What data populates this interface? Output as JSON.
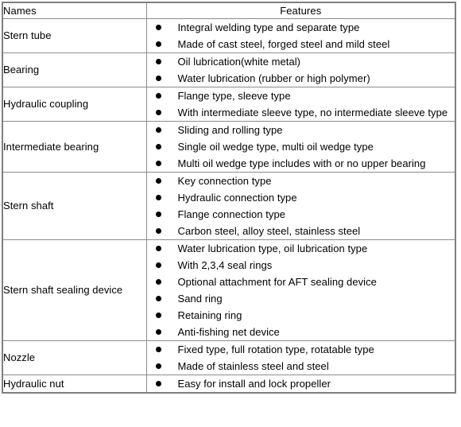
{
  "table": {
    "columns": [
      {
        "key": "names",
        "label": "Names",
        "align": "left"
      },
      {
        "key": "features",
        "label": "Features",
        "align": "center"
      }
    ],
    "bullet_glyph": "●",
    "border_color": "#7f7f7f",
    "text_color": "#000000",
    "background_color": "#ffffff",
    "rows": [
      {
        "name": "Stern tube",
        "features": [
          "Integral welding type and separate type",
          "Made of cast steel, forged steel and mild steel"
        ]
      },
      {
        "name": "Bearing",
        "features": [
          "Oil lubrication(white metal)",
          "Water lubrication (rubber or high polymer)"
        ]
      },
      {
        "name": "Hydraulic coupling",
        "features": [
          "Flange type, sleeve type",
          "With intermediate sleeve type, no intermediate sleeve type"
        ]
      },
      {
        "name": "Intermediate bearing",
        "features": [
          "Sliding and rolling type",
          "Single oil wedge type, multi oil wedge type",
          "Multi oil wedge type includes with or no upper bearing"
        ]
      },
      {
        "name": "Stern shaft",
        "features": [
          "Key connection type",
          "Hydraulic connection type",
          "Flange connection type",
          "Carbon steel, alloy steel, stainless steel"
        ]
      },
      {
        "name": "Stern shaft sealing device",
        "features": [
          "Water lubrication type, oil lubrication type",
          "With 2,3,4 seal rings",
          "Optional attachment for AFT sealing device",
          "Sand ring",
          "Retaining ring",
          "Anti-fishing net device"
        ]
      },
      {
        "name": "Nozzle",
        "features": [
          "Fixed type, full rotation type, rotatable type",
          "Made of stainless steel and steel"
        ]
      },
      {
        "name": "Hydraulic nut",
        "features": [
          "Easy for install and lock propeller"
        ]
      }
    ]
  }
}
